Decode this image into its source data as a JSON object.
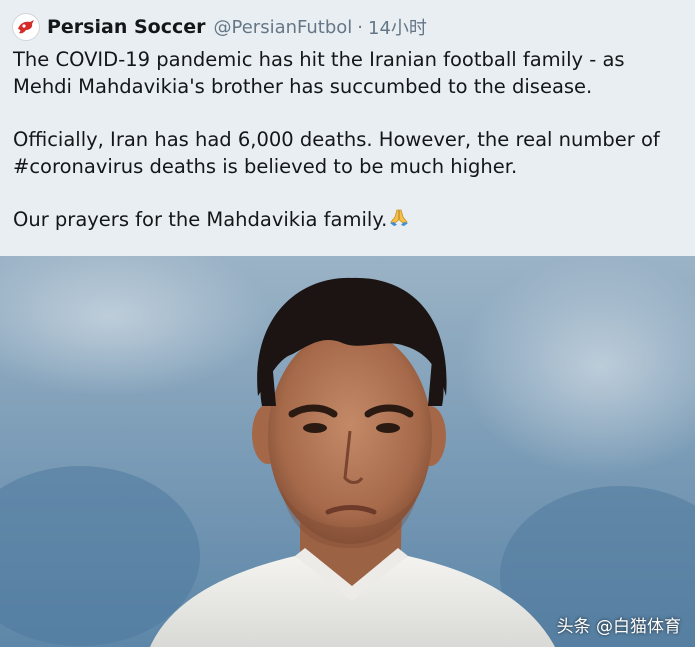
{
  "header": {
    "display_name": "Persian Soccer",
    "handle": "@PersianFutbol",
    "separator": "·",
    "time": "14小时"
  },
  "tweet": {
    "paragraphs": [
      "The COVID-19 pandemic has hit the Iranian football family - as Mehdi Mahdavikia's brother has succumbed to the disease.",
      "Officially, Iran has had 6,000 deaths. However, the real number of #coronavirus deaths is believed to be much higher.",
      "Our prayers for the Mahdavikia family."
    ],
    "emoji": "folded-hands-icon"
  },
  "photo": {
    "subject": "player-portrait-photo",
    "watermark": "头条 @白猫体育"
  },
  "colors": {
    "background": "#e9eef2",
    "text": "#14171a",
    "secondary": "#657786",
    "brand_red": "#d42b2b"
  }
}
